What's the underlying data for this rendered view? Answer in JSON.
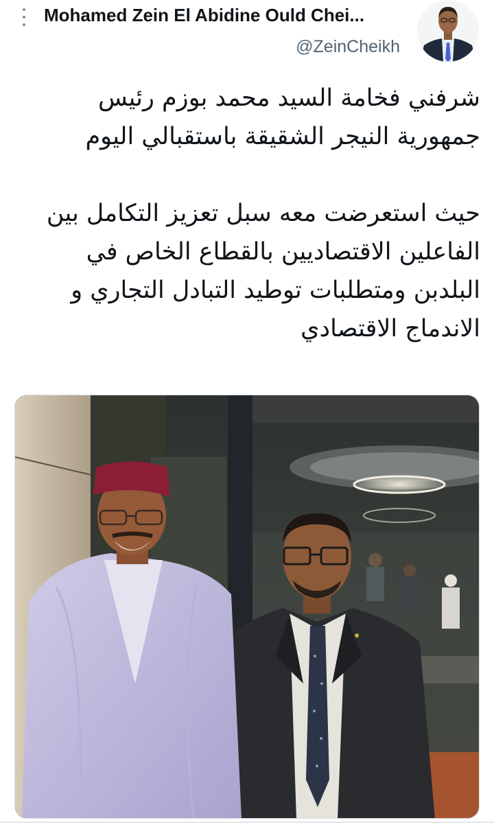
{
  "tweet": {
    "author": {
      "display_name": "Mohamed Zein El Abidine Ould Chei...",
      "handle": "@ZeinCheikh"
    },
    "text_lines": [
      "شرفني فخامة السيد  محمد بوزم  رئيس",
      "جمهورية النيجر الشقيقة باستقبالي اليوم",
      "",
      "حيث استعرضت معه سبل تعزيز التكامل بين",
      "الفاعلين الاقتصاديين  بالقطاع الخاص في",
      "البلدبن ومتطلبات توطيد التبادل التجاري و",
      "الاندماج الاقتصادي"
    ]
  },
  "icons": {
    "more": "more-vertical-icon"
  },
  "colors": {
    "text_primary": "#0f1419",
    "text_secondary": "#536471",
    "divider": "#e3e6e8"
  }
}
